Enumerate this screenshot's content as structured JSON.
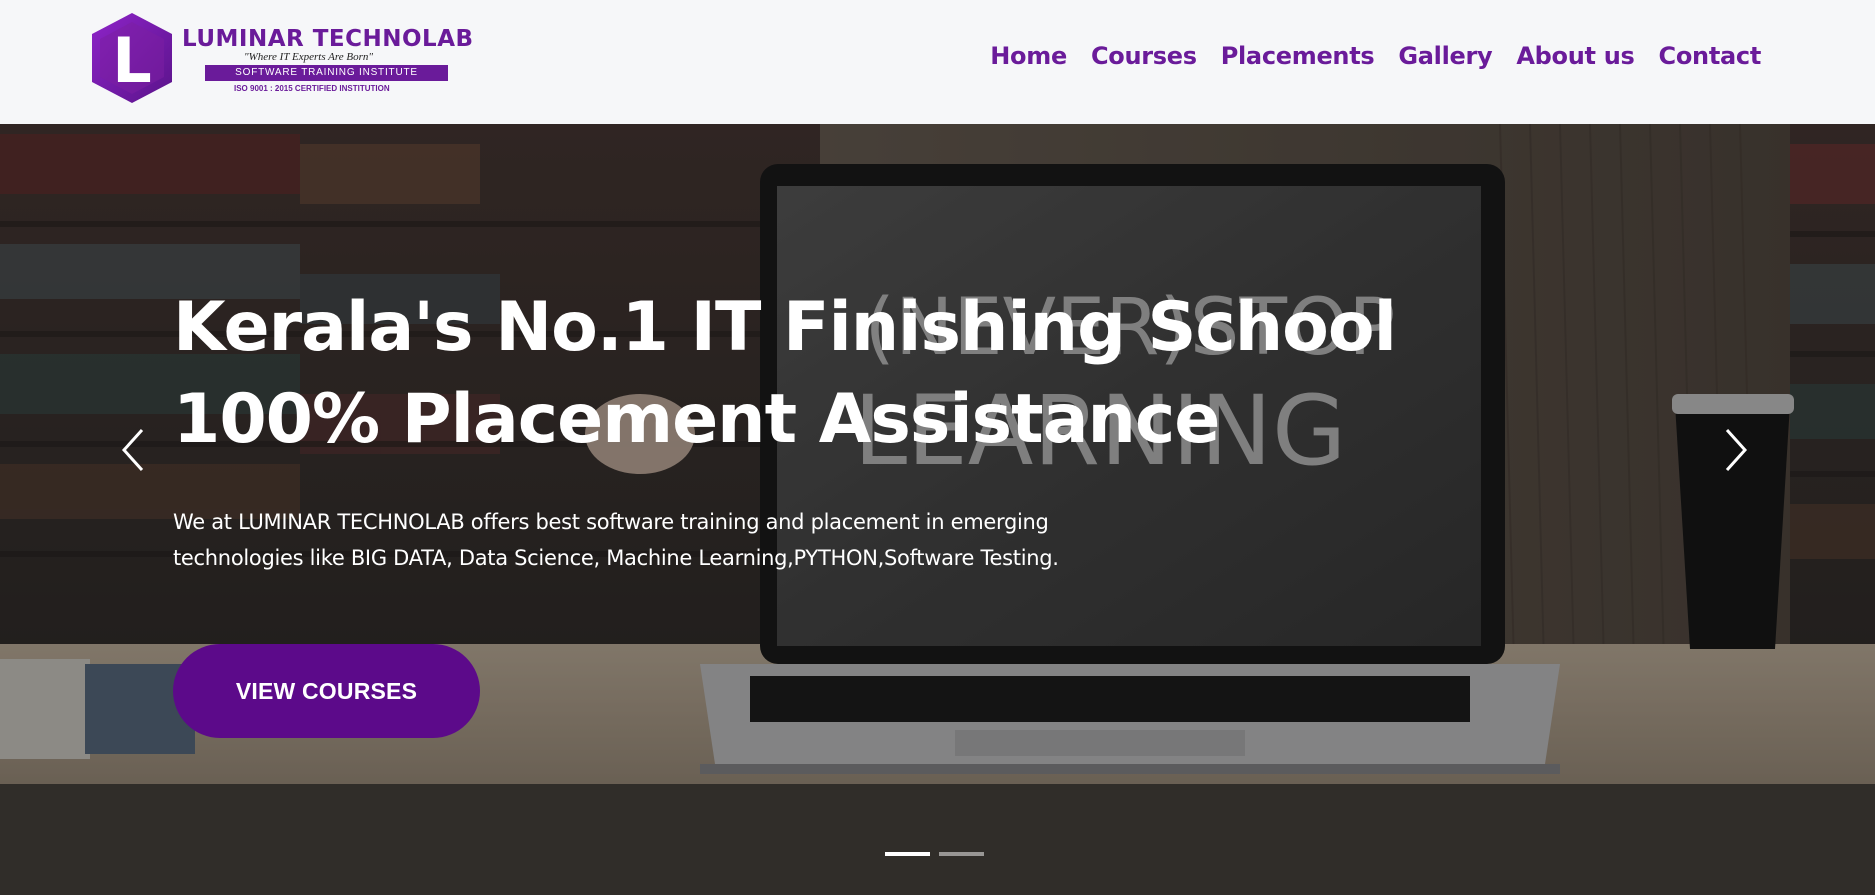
{
  "logo": {
    "brand": "LUMINAR TECHNOLAB",
    "tagline": "\"Where IT Experts Are Born\"",
    "banner": "SOFTWARE TRAINING INSTITUTE",
    "certification": "ISO 9001 : 2015 CERTIFIED INSTITUTION",
    "mark": "L",
    "accent_color": "#6a1b9a"
  },
  "nav": {
    "items": [
      {
        "label": "Home"
      },
      {
        "label": "Courses"
      },
      {
        "label": "Placements"
      },
      {
        "label": "Gallery"
      },
      {
        "label": "About us"
      },
      {
        "label": "Contact"
      }
    ]
  },
  "hero": {
    "title_line1": "Kerala's No.1 IT Finishing School",
    "title_line2": "100% Placement Assistance",
    "description": "We at LUMINAR TECHNOLAB offers best software training and placement in emerging technologies like BIG DATA, Data Science, Machine Learning,PYTHON,Software Testing.",
    "cta_label": "VIEW COURSES",
    "cta_color": "#5c0a8a",
    "chalkboard_line1": "(NEVER)STOP",
    "chalkboard_line2": "LEARNING",
    "slides": {
      "total": 2,
      "active": 1
    },
    "prev_icon": "chevron-left-icon",
    "next_icon": "chevron-right-icon"
  }
}
